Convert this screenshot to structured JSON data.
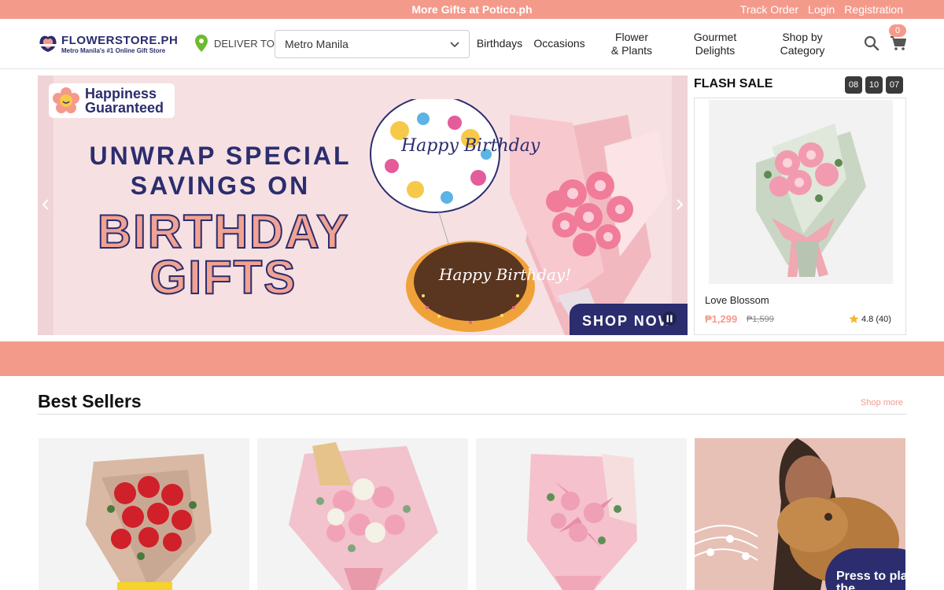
{
  "topbar": {
    "promo": "More Gifts at Potico.ph",
    "links": [
      "Track Order",
      "Login",
      "Registration"
    ]
  },
  "header": {
    "logo_name": "FLOWERSTORE.PH",
    "logo_tagline": "Metro Manila's #1 Online Gift Store",
    "deliver_label": "DELIVER TO",
    "location_value": "Metro Manila",
    "nav": [
      {
        "line1": "Birthdays",
        "line2": ""
      },
      {
        "line1": "Occasions",
        "line2": ""
      },
      {
        "line1": "Flower",
        "line2": "& Plants"
      },
      {
        "line1": "Gourmet",
        "line2": "Delights"
      },
      {
        "line1": "Shop by",
        "line2": "Category"
      }
    ],
    "cart_count": "0"
  },
  "hero": {
    "badge": "Happiness Guaranteed",
    "line1": "UNWRAP SPECIAL",
    "line2": "SAVINGS ON",
    "big1": "BIRTHDAY",
    "big2": "GIFTS",
    "balloon_text": "Happy Birthday",
    "cake_text": "Happy Birthday!",
    "cta": "SHOP NOW"
  },
  "flash_sale": {
    "title": "FLASH SALE",
    "timer": [
      "08",
      "10",
      "07"
    ],
    "product": {
      "name": "Love Blossom",
      "price": "₱1,299",
      "old_price": "₱1,599",
      "rating": "4.8",
      "reviews": "(40)"
    }
  },
  "best_sellers": {
    "title": "Best Sellers",
    "shop_more": "Shop more",
    "press_badge": "Press to play the"
  },
  "colors": {
    "accent": "#f49a8b",
    "navy": "#2b2d6e"
  }
}
